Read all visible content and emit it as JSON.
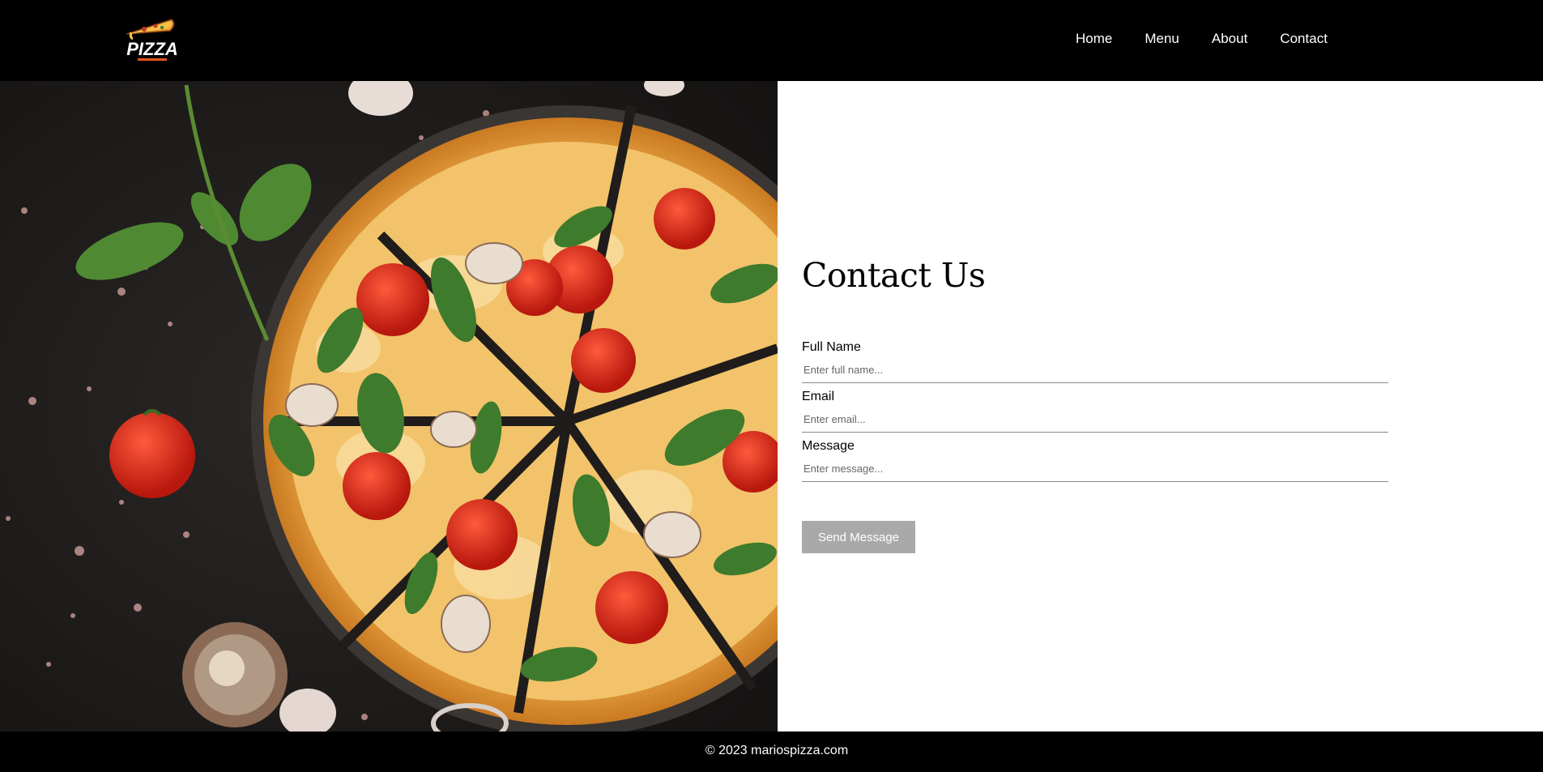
{
  "header": {
    "logo_text": "PIZZA",
    "nav": [
      {
        "label": "Home"
      },
      {
        "label": "Menu"
      },
      {
        "label": "About"
      },
      {
        "label": "Contact"
      }
    ]
  },
  "hero": {
    "image": "pizza-photo"
  },
  "contact": {
    "title": "Contact Us",
    "fields": {
      "name": {
        "label": "Full Name",
        "placeholder": "Enter full name..."
      },
      "email": {
        "label": "Email",
        "placeholder": "Enter email..."
      },
      "message": {
        "label": "Message",
        "placeholder": "Enter message..."
      }
    },
    "submit_label": "Send Message"
  },
  "footer": {
    "text": "© 2023 mariospizza.com"
  },
  "colors": {
    "header_bg": "#000000",
    "button_bg": "#a9a9a9",
    "footer_bg": "#000000"
  }
}
